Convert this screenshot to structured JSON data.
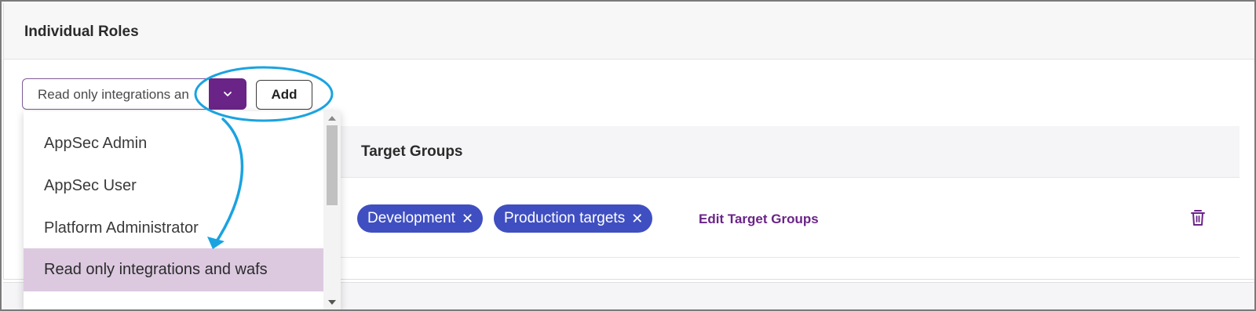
{
  "section": {
    "title": "Individual Roles"
  },
  "role_select": {
    "current_value": "Read only integrations an",
    "toggle_icon": "chevron-down-icon",
    "add_label": "Add"
  },
  "dropdown": {
    "items": [
      {
        "label": "AppSec Admin"
      },
      {
        "label": "AppSec User"
      },
      {
        "label": "Platform Administrator"
      },
      {
        "label": "Read only integrations and wafs",
        "selected": true
      }
    ]
  },
  "target_groups": {
    "header": "Target Groups",
    "chips": [
      {
        "label": "Development",
        "remove": "✕"
      },
      {
        "label": "Production targets",
        "remove": "✕"
      }
    ],
    "edit_label": "Edit Target Groups",
    "delete_icon": "trash-icon"
  },
  "colors": {
    "brand_purple": "#6a2487",
    "chip_blue": "#3f4fc1",
    "selected_bg": "#dcc9e0",
    "annotation_cyan": "#1aa3e0"
  }
}
